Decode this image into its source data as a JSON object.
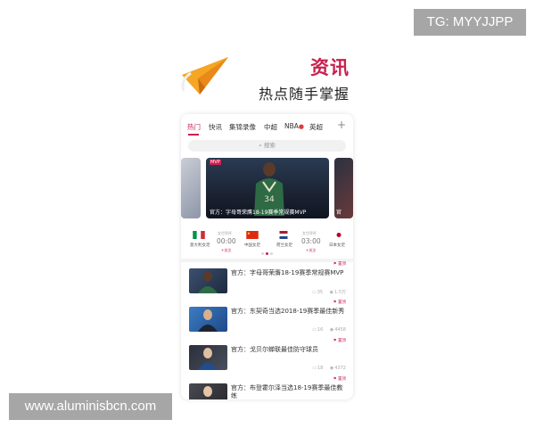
{
  "watermarks": {
    "top": "TG: MYYJJPP",
    "bottom": "www.aluminisbcn.com"
  },
  "hero": {
    "title": "资讯",
    "subtitle": "热点随手掌握"
  },
  "tabs": [
    {
      "label": "热门",
      "active": true
    },
    {
      "label": "快讯"
    },
    {
      "label": "集锦录像"
    },
    {
      "label": "中超"
    },
    {
      "label": "NBA"
    },
    {
      "label": "英超"
    }
  ],
  "search": {
    "placeholder": "搜索"
  },
  "carousel": {
    "main_caption": "官方：字母哥荣膺18-19赛季常规赛MVP",
    "side_caption": "官",
    "tag": "MVP"
  },
  "matches": [
    {
      "home": "意大利女足",
      "away": "中国女足",
      "status": "女世界杯",
      "time": "00:00",
      "action": "+关注"
    },
    {
      "home": "荷兰女足",
      "away": "日本女足",
      "status": "女世界杯",
      "time": "03:00",
      "action": "+关注"
    }
  ],
  "news": [
    {
      "title": "官方：字母哥荣膺18-19赛季常规赛MVP",
      "tag": "置顶",
      "comments": "35",
      "views": "1.5万"
    },
    {
      "title": "官方：东契奇当选2018-19赛季最佳新秀",
      "tag": "置顶",
      "comments": "16",
      "views": "4458"
    },
    {
      "title": "官方：戈贝尔蝉联最佳防守球员",
      "tag": "置顶",
      "comments": "18",
      "views": "4372"
    },
    {
      "title": "官方：布登霍尔泽当选18-19赛季最佳教练",
      "tag": "置顶"
    }
  ],
  "colors": {
    "accent": "#c8204e",
    "plane_orange": "#f5a623"
  },
  "icons": {
    "plus": "plus-icon",
    "search": "search-icon",
    "flame": "flame-icon",
    "comment": "comment-icon",
    "eye": "eye-icon"
  }
}
